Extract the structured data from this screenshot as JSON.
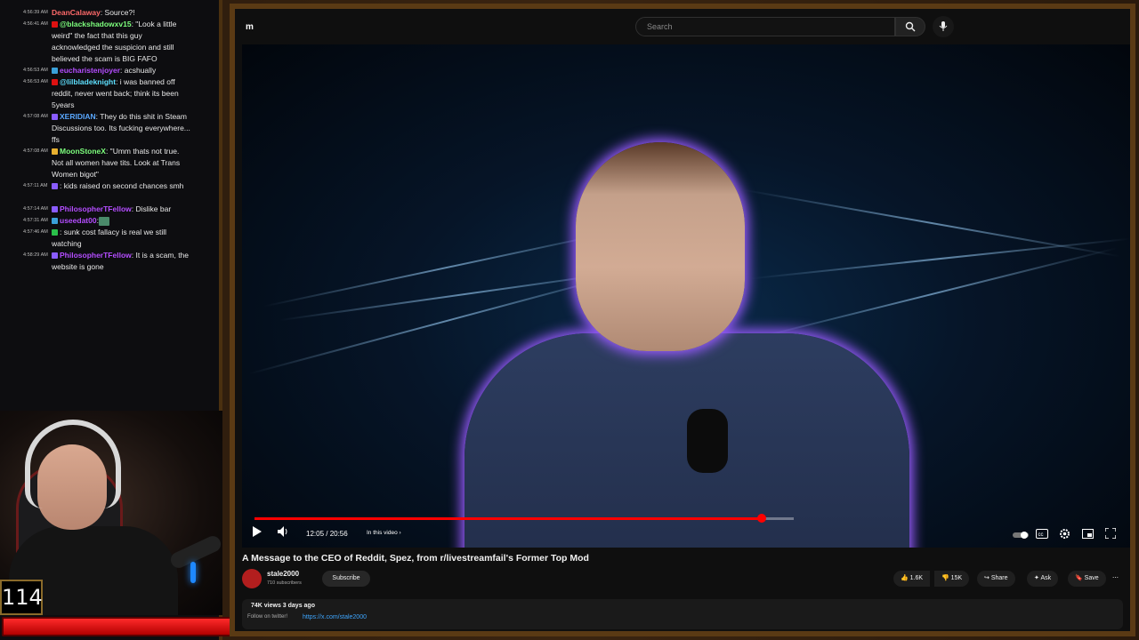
{
  "chat": {
    "messages": [
      {
        "time": "4:56:39 AM",
        "user": "DeanCalaway",
        "text": ": Source?!",
        "color": "#ff6a6a"
      },
      {
        "time": "4:56:41 AM",
        "user": "@blackshadowxv15",
        "text": ": \"Look a little weird\" the fact that this guy acknowledged the suspicion and still believed the scam is BIG FAFO",
        "color": "#7dff7d"
      },
      {
        "time": "4:56:53 AM",
        "user": "eucharistenjoyer",
        "text": ": acshually",
        "color": "#b44dff"
      },
      {
        "time": "4:56:53 AM",
        "user": "@lilbladeknight",
        "text": ": i was banned off reddit, never went back; think its been 5years",
        "color": "#5ee0ff"
      },
      {
        "time": "4:57:08 AM",
        "user": "XERIDIAN",
        "text": ": They do this shit in Steam Discussions too. Its fucking everywhere... ffs",
        "color": "#5aa8ff"
      },
      {
        "time": "4:57:08 AM",
        "user": "MoonStoneX",
        "text": ": \"Umm thats not true. Not all women have tits. Look at Trans Women bigot\"",
        "color": "#7dff7d"
      },
      {
        "time": "4:57:11 AM",
        "user": "",
        "text": ": kids raised on second chances smh",
        "color": "#cccccc"
      },
      {
        "time": "4:57:14 AM",
        "user": "PhilosopherTFellow",
        "text": ": Dislike bar",
        "color": "#b44dff"
      },
      {
        "time": "4:57:31 AM",
        "user": "useedat00",
        "text": ":",
        "color": "#b44dff"
      },
      {
        "time": "4:57:46 AM",
        "user": "",
        "text": ": sunk cost fallacy is real we still watching",
        "color": "#cccccc"
      },
      {
        "time": "4:58:29 AM",
        "user": "PhilosopherTFellow",
        "text": ": It is a scam, the website is gone",
        "color": "#b44dff"
      }
    ]
  },
  "overlay": {
    "counter": "114",
    "health_fraction": 1.0
  },
  "youtube": {
    "logo": "m",
    "search_placeholder": "Search",
    "search_icon": "search-icon",
    "mic_icon": "mic-icon"
  },
  "player": {
    "time": "12:05 / 20:56",
    "chapter": "In this video ›",
    "progress_fraction": 0.94
  },
  "video": {
    "title": "A Message to the CEO of Reddit, Spez, from r/livestreamfail's Former Top Mod",
    "channel": "stale2000",
    "subscribers": "710 subscribers",
    "subscribe_label": "Subscribe",
    "likes": "1.6K",
    "dislikes": "15K",
    "share_label": "Share",
    "ask_label": "Ask",
    "save_label": "Save",
    "meta": "74K views  3 days ago",
    "follow_text": "Follow on twitter!",
    "link": "https://x.com/stale2000"
  },
  "colors": {
    "accent_red": "#ff0000",
    "link_blue": "#3ea6ff",
    "frame_brown": "#5a3a14"
  }
}
